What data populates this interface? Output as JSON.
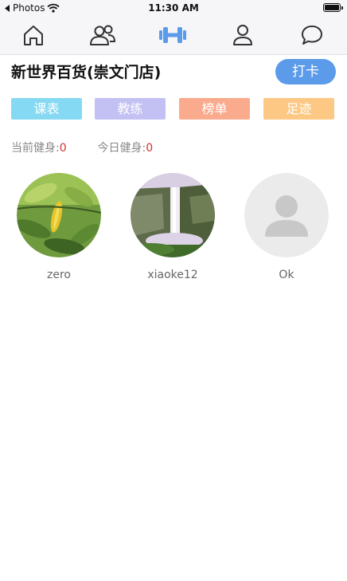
{
  "status_bar": {
    "back_label": "Photos",
    "time": "11:30 AM"
  },
  "nav": {
    "accent_color": "#5b9bea",
    "items": [
      {
        "icon": "home-icon"
      },
      {
        "icon": "people-icon"
      },
      {
        "icon": "dumbbell-icon",
        "active": true
      },
      {
        "icon": "person-icon"
      },
      {
        "icon": "chat-bubble-icon"
      }
    ]
  },
  "header": {
    "store_name": "新世界百货(崇文门店)",
    "checkin_label": "打卡"
  },
  "tabs": [
    {
      "label": "课表",
      "color": "#86d9f3"
    },
    {
      "label": "教练",
      "color": "#c3c0f3"
    },
    {
      "label": "榜单",
      "color": "#fbab8d"
    },
    {
      "label": "足迹",
      "color": "#fdc884"
    }
  ],
  "stats": {
    "current_label": "当前健身:",
    "current_value": "0",
    "today_label": "今日健身:",
    "today_value": "0"
  },
  "members": [
    {
      "name": "zero",
      "avatar": "leaves-photo"
    },
    {
      "name": "xiaoke12",
      "avatar": "waterfall-photo"
    },
    {
      "name": "Ok",
      "avatar": "default-person-placeholder"
    }
  ]
}
